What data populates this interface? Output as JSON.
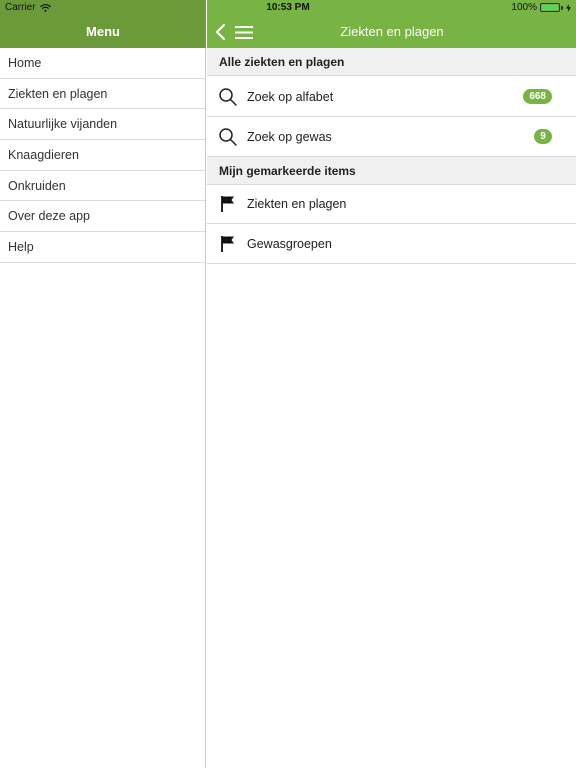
{
  "status": {
    "carrier": "Carrier",
    "time": "10:53 PM",
    "battery": "100%"
  },
  "menu": {
    "title": "Menu",
    "items": [
      {
        "label": "Home"
      },
      {
        "label": "Ziekten en plagen"
      },
      {
        "label": "Natuurlijke vijanden"
      },
      {
        "label": "Knaagdieren"
      },
      {
        "label": "Onkruiden"
      },
      {
        "label": "Over deze app"
      },
      {
        "label": "Help"
      }
    ]
  },
  "main": {
    "title": "Ziekten en plagen",
    "section1": {
      "title": "Alle ziekten en plagen",
      "rows": [
        {
          "label": "Zoek op alfabet",
          "count": "668",
          "icon": "search-icon"
        },
        {
          "label": "Zoek op gewas",
          "count": "9",
          "icon": "search-icon"
        }
      ]
    },
    "section2": {
      "title": "Mijn gemarkeerde items",
      "rows": [
        {
          "label": "Ziekten en plagen",
          "icon": "flag-icon"
        },
        {
          "label": "Gewasgroepen",
          "icon": "flag-icon"
        }
      ]
    }
  },
  "colors": {
    "header_left": "#6c9a3a",
    "header_right": "#78b443",
    "badge": "#78b443"
  }
}
